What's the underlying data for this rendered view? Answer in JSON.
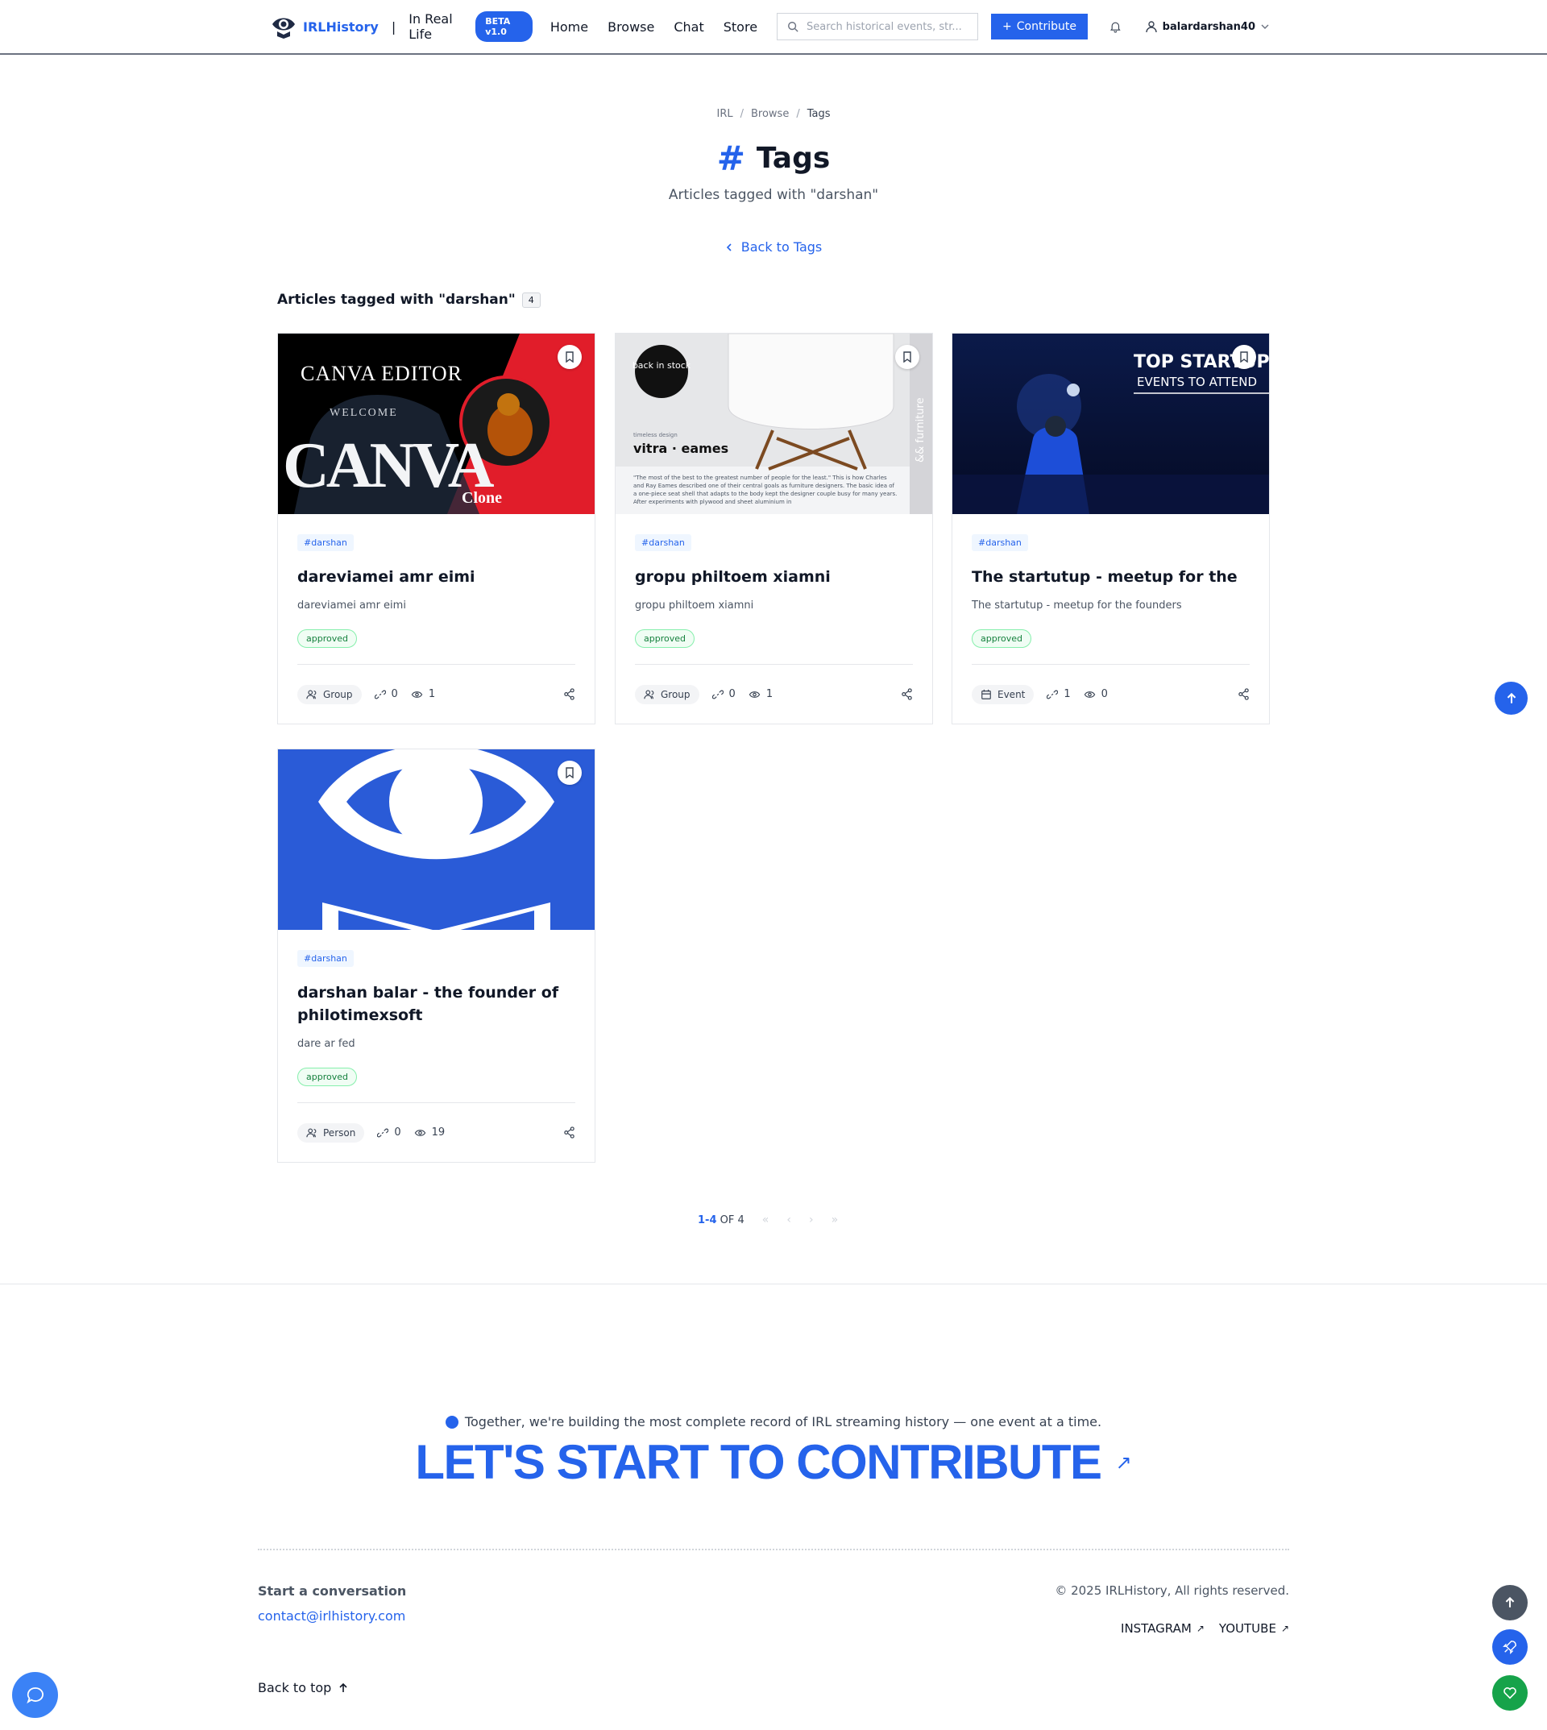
{
  "header": {
    "brand": "IRLHistory",
    "separator": "|",
    "subtitle": "In Real Life",
    "beta": "BETA v1.0",
    "nav": [
      "Home",
      "Browse",
      "Chat",
      "Store"
    ],
    "search_placeholder": "Search historical events, str...",
    "contribute": "Contribute",
    "username": "balardarshan40"
  },
  "breadcrumb": [
    "IRL",
    "Browse",
    "Tags"
  ],
  "page": {
    "title": "Tags",
    "hash": "#",
    "subtitle": "Articles tagged with \"darshan\"",
    "back": "Back to Tags",
    "section_title": "Articles tagged with \"darshan\"",
    "count": "4"
  },
  "cards": [
    {
      "tag": "#darshan",
      "title": "dareviamei amr eimi",
      "desc": "dareviamei amr eimi",
      "status": "approved",
      "type": "Group",
      "links": "0",
      "views": "1",
      "image_text": {
        "line1": "CANVA EDITOR",
        "line2": "WELCOME",
        "line3": "CANVA",
        "line4": "Clone"
      }
    },
    {
      "tag": "#darshan",
      "title": "gropu philtoem xiamni",
      "desc": "gropu philtoem xiamni",
      "status": "approved",
      "type": "Group",
      "links": "0",
      "views": "1",
      "image_text": {
        "badge": "back in stock",
        "small": "timeless design",
        "brand": "vitra · eames",
        "side": "&& furniture",
        "body": "\"The most of the best to the greatest number of people for the least.\" This is how Charles and Ray Eames described one of their central goals as furniture designers. The basic idea of a one-piece seat shell that adapts to the body kept the designer couple busy for many years. After experiments with plywood and sheet aluminium in"
      }
    },
    {
      "tag": "#darshan",
      "title": "The startutup - meetup for the",
      "desc": "The startutup - meetup for the founders",
      "status": "approved",
      "type": "Event",
      "links": "1",
      "views": "0",
      "image_text": {
        "line1": "TOP STARTUP",
        "line2": "EVENTS TO ATTEND"
      }
    },
    {
      "tag": "#darshan",
      "title": "darshan balar - the founder of philotimexsoft",
      "desc": "dare ar fed",
      "status": "approved",
      "type": "Person",
      "links": "0",
      "views": "19"
    }
  ],
  "pagination": {
    "range": "1-4",
    "of": "OF 4",
    "first": "«",
    "prev": "‹",
    "next": "›",
    "last": "»"
  },
  "footer": {
    "tagline": "Together, we're building the most complete record of IRL streaming history — one event at a time.",
    "cta": "LET'S START TO CONTRIBUTE",
    "cta_arrow": "↗",
    "conversation": "Start a conversation",
    "email": "contact@irlhistory.com",
    "copyright": "© 2025 IRLHistory, All rights reserved.",
    "instagram": "INSTAGRAM",
    "youtube": "YOUTUBE",
    "back_to_top": "Back to top"
  },
  "colors": {
    "accent": "#2563eb",
    "approved": "#15803d",
    "canva_red": "#e11d2a"
  }
}
